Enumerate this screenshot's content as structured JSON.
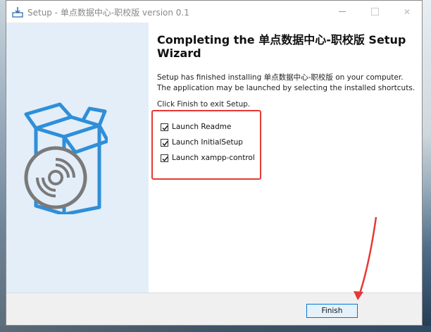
{
  "window": {
    "title": "Setup - 单点数据中心-职校版 version 0.1"
  },
  "wizard": {
    "heading": "Completing the 单点数据中心-职校版 Setup Wizard",
    "description": "Setup has finished installing 单点数据中心-职校版 on your computer. The application may be launched by selecting the installed shortcuts.",
    "instruction": "Click Finish to exit Setup.",
    "options": [
      {
        "label": "Launch Readme",
        "checked": true
      },
      {
        "label": "Launch InitialSetup",
        "checked": true
      },
      {
        "label": "Launch xampp-control",
        "checked": true
      }
    ],
    "finish_label": "Finish"
  },
  "colors": {
    "highlight": "#e53935",
    "accent": "#0078d7",
    "sidebar": "#e3eef9",
    "box_icon": "#2f8fd8"
  },
  "icons": [
    "setup-icon",
    "minimize-icon",
    "maximize-icon",
    "close-icon",
    "software-box-icon",
    "check-icon"
  ]
}
